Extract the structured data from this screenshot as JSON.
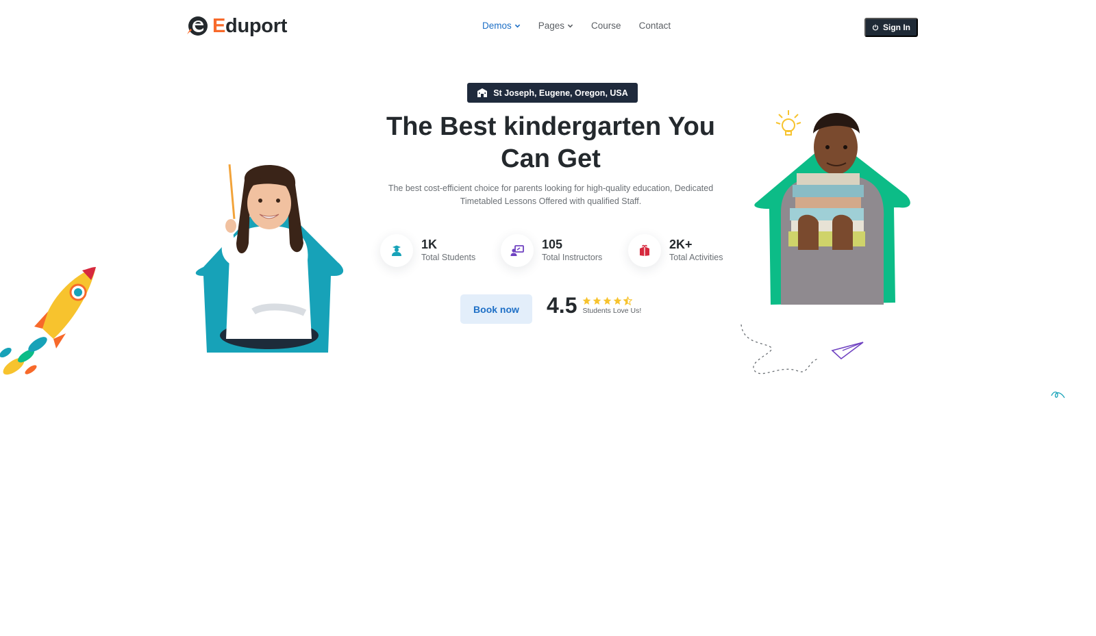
{
  "brand": {
    "name_first": "E",
    "name_rest": "duport",
    "accent_color": "#f7692a"
  },
  "nav": {
    "items": [
      {
        "label": "Demos",
        "active": true,
        "has_dropdown": true
      },
      {
        "label": "Pages",
        "active": false,
        "has_dropdown": true
      },
      {
        "label": "Course",
        "active": false,
        "has_dropdown": false
      },
      {
        "label": "Contact",
        "active": false,
        "has_dropdown": false
      }
    ],
    "active_color": "#1d6fc6"
  },
  "header": {
    "signin_label": "Sign In",
    "signin_icon": "power-icon"
  },
  "hero": {
    "location_icon": "school-building-icon",
    "location": "St Joseph, Eugene, Oregon, USA",
    "title_line1": "The Best kindergarten You",
    "title_line2": "Can Get",
    "description_line1": "The best cost-efficient choice for parents looking for high-quality education, Dedicated",
    "description_line2": "Timetabled Lessons Offered with qualified Staff.",
    "stats": [
      {
        "value": "1K",
        "label": "Total Students",
        "icon": "student-icon",
        "color": "#17a2b8"
      },
      {
        "value": "105",
        "label": "Total Instructors",
        "icon": "instructor-board-icon",
        "color": "#6f42c1"
      },
      {
        "value": "2K+",
        "label": "Total Activities",
        "icon": "gift-box-icon",
        "color": "#d6293e"
      }
    ],
    "book_label": "Book now",
    "rating": {
      "value": "4.5",
      "stars": 4.5,
      "label": "Students Love Us!",
      "star_color": "#f7c32e"
    }
  },
  "illustrations": {
    "left_house_color": "#17a2b8",
    "right_house_color": "#0cbc87"
  }
}
